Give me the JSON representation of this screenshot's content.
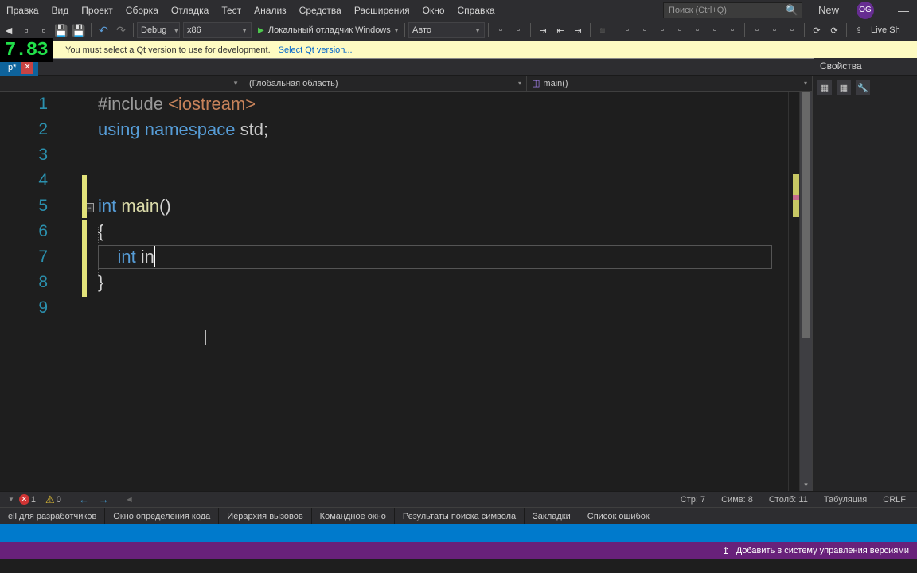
{
  "menu": {
    "items": [
      "Правка",
      "Вид",
      "Проект",
      "Сборка",
      "Отладка",
      "Тест",
      "Анализ",
      "Средства",
      "Расширения",
      "Окно",
      "Справка"
    ],
    "search_placeholder": "Поиск (Ctrl+Q)",
    "new_label": "New",
    "user_initials": "OG"
  },
  "toolbar": {
    "config": "Debug",
    "platform": "x86",
    "debugger": "Локальный отладчик Windows",
    "auto": "Авто",
    "liveshare": "Live Sh"
  },
  "notice": {
    "msg": "You must select a Qt version to use for development.",
    "link": "Select Qt version..."
  },
  "overlay": {
    "num": "7.83"
  },
  "tab": {
    "name": "p*",
    "close": "✕"
  },
  "scope": {
    "left": "",
    "mid": "(Глобальная область)",
    "right": "main()"
  },
  "properties_label": "Свойства",
  "code": {
    "lines": [
      {
        "n": 1,
        "seg": [
          {
            "t": "#include ",
            "c": "tok-pre"
          },
          {
            "t": "<iostream>",
            "c": "tok-str"
          }
        ]
      },
      {
        "n": 2,
        "seg": [
          {
            "t": "using ",
            "c": "tok-kw"
          },
          {
            "t": "namespace ",
            "c": "tok-kw"
          },
          {
            "t": "std",
            "c": "tok-ns"
          },
          {
            "t": ";",
            "c": "tok-pl"
          }
        ]
      },
      {
        "n": 3,
        "seg": []
      },
      {
        "n": 4,
        "seg": []
      },
      {
        "n": 5,
        "seg": [
          {
            "t": "int ",
            "c": "tok-ty"
          },
          {
            "t": "main",
            "c": "tok-fn"
          },
          {
            "t": "()",
            "c": "tok-pl"
          }
        ]
      },
      {
        "n": 6,
        "seg": [
          {
            "t": "{",
            "c": "tok-pl"
          }
        ]
      },
      {
        "n": 7,
        "seg": [
          {
            "t": "    int ",
            "c": "tok-ty"
          },
          {
            "t": "in",
            "c": "tok-pl"
          }
        ],
        "active": true
      },
      {
        "n": 8,
        "seg": [
          {
            "t": "}",
            "c": "tok-pl"
          }
        ]
      },
      {
        "n": 9,
        "seg": []
      }
    ]
  },
  "status": {
    "errors": "1",
    "warnings": "0",
    "line": "Стр: 7",
    "char": "Симв: 8",
    "col": "Столб: 11",
    "tab": "Табуляция",
    "crlf": "CRLF"
  },
  "bottom_tabs": [
    "ell для разработчиков",
    "Окно определения кода",
    "Иерархия вызовов",
    "Командное окно",
    "Результаты поиска символа",
    "Закладки",
    "Список ошибок"
  ],
  "src_control": "Добавить в систему управления версиями"
}
